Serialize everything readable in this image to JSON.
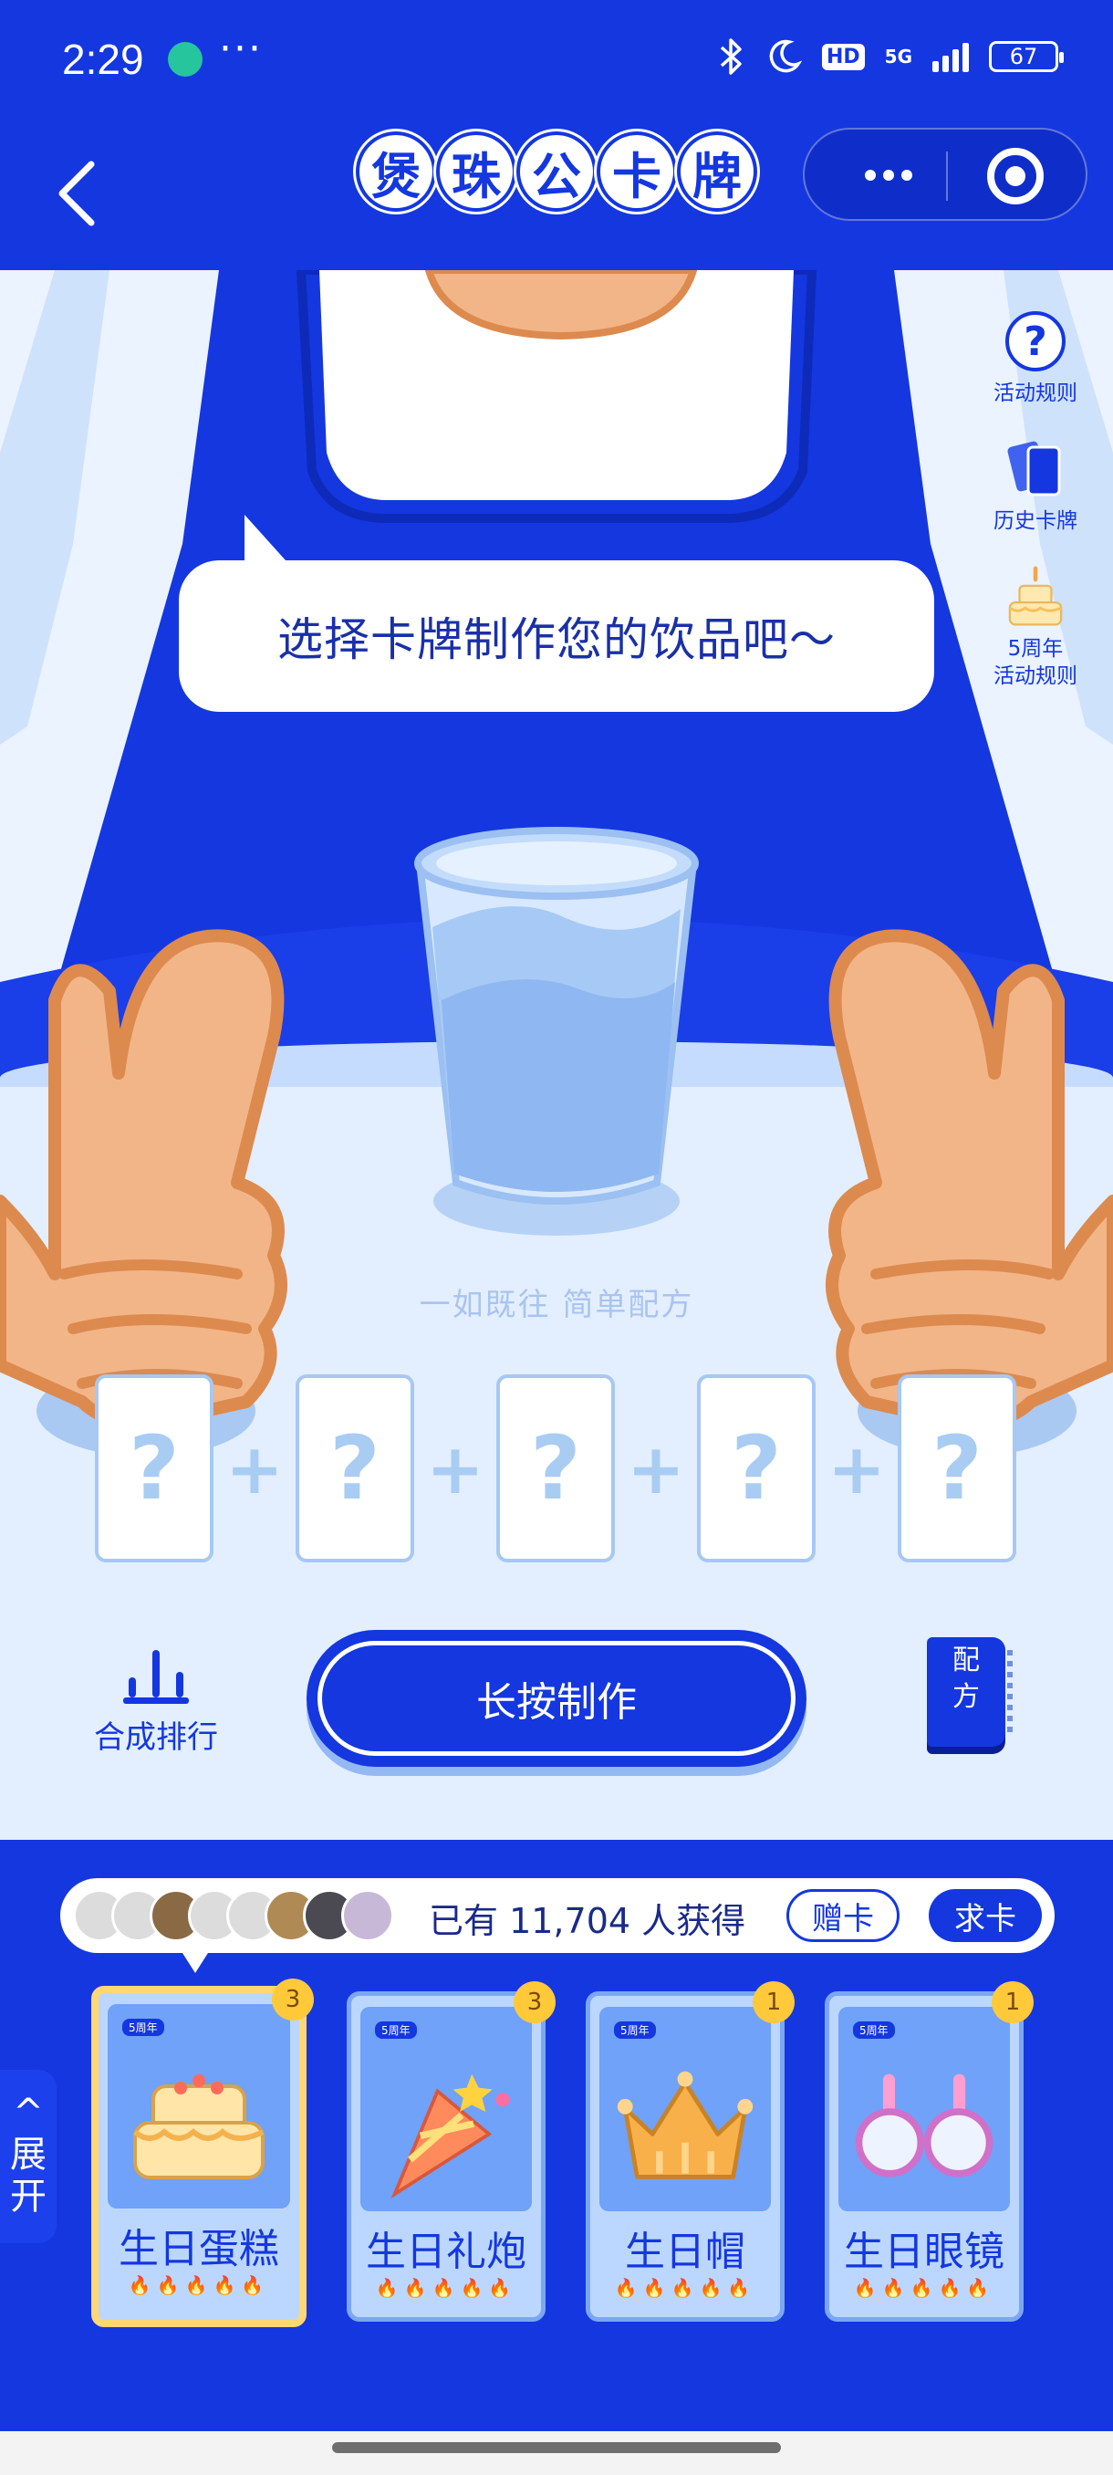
{
  "status_bar": {
    "time": "2:29",
    "more": "···",
    "network": "5G",
    "hd": "HD",
    "battery": "67"
  },
  "title_bar": {
    "title_chars": [
      "煲",
      "珠",
      "公",
      "卡",
      "牌"
    ]
  },
  "scene": {
    "speech": "选择卡牌制作您的饮品吧～",
    "side_tools": [
      {
        "label": "活动规则",
        "icon": "question-icon"
      },
      {
        "label": "历史卡牌",
        "icon": "cards-icon"
      },
      {
        "label": "5周年\n活动规则",
        "icon": "cake-icon"
      }
    ],
    "recipe_hint": "一如既往 简单配方",
    "slots": [
      "?",
      "?",
      "?",
      "?",
      "?"
    ],
    "plus": "+",
    "rank_label": "合成排行",
    "make_label": "长按制作",
    "recipe_book_label": "配\n方"
  },
  "panel": {
    "owners_text": "已有 11,704 人获得",
    "gift_label": "赠卡",
    "ask_label": "求卡",
    "expand_label": "^\n展\n开",
    "cards": [
      {
        "name": "生日蛋糕",
        "count": "3",
        "badge": "5周年",
        "flames": "🔥🔥🔥🔥🔥",
        "art": "cake",
        "selected": true
      },
      {
        "name": "生日礼炮",
        "count": "3",
        "badge": "5周年",
        "flames": "🔥🔥🔥🔥🔥",
        "art": "popper",
        "selected": false
      },
      {
        "name": "生日帽",
        "count": "1",
        "badge": "5周年",
        "flames": "🔥🔥🔥🔥🔥",
        "art": "crown",
        "selected": false
      },
      {
        "name": "生日眼镜",
        "count": "1",
        "badge": "5周年",
        "flames": "🔥🔥🔥🔥🔥",
        "art": "glasses",
        "selected": false
      }
    ]
  },
  "colors": {
    "brand_blue": "#1437e0",
    "light_bg": "#e3efff",
    "count_badge": "#ffc93a"
  }
}
